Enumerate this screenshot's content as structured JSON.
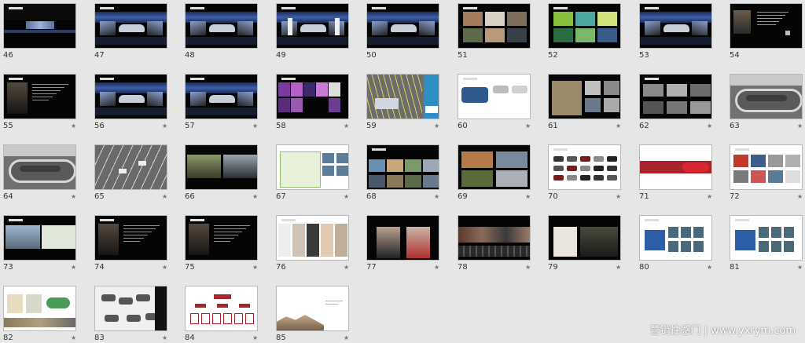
{
  "colors": {
    "background": "#e6e6e6",
    "star": "#777777"
  },
  "slides": [
    {
      "n": "46",
      "star": false,
      "v": "stage-wide"
    },
    {
      "n": "47",
      "star": false,
      "v": "stage"
    },
    {
      "n": "48",
      "star": false,
      "v": "stage"
    },
    {
      "n": "49",
      "star": false,
      "v": "stage-panels"
    },
    {
      "n": "50",
      "star": false,
      "v": "stage"
    },
    {
      "n": "51",
      "star": false,
      "v": "grid-photos"
    },
    {
      "n": "52",
      "star": false,
      "v": "green-grid"
    },
    {
      "n": "53",
      "star": false,
      "v": "stage"
    },
    {
      "n": "54",
      "star": false,
      "v": "people-text"
    },
    {
      "n": "55",
      "star": true,
      "v": "portrait-text"
    },
    {
      "n": "56",
      "star": true,
      "v": "stage"
    },
    {
      "n": "57",
      "star": true,
      "v": "stage"
    },
    {
      "n": "58",
      "star": true,
      "v": "purple-collage"
    },
    {
      "n": "59",
      "star": true,
      "v": "parking-blue"
    },
    {
      "n": "60",
      "star": true,
      "v": "white-cars"
    },
    {
      "n": "61",
      "star": true,
      "v": "map-photos"
    },
    {
      "n": "62",
      "star": true,
      "v": "dark-photos"
    },
    {
      "n": "63",
      "star": true,
      "v": "track"
    },
    {
      "n": "64",
      "star": true,
      "v": "track"
    },
    {
      "n": "65",
      "star": true,
      "v": "track-cars"
    },
    {
      "n": "66",
      "star": true,
      "v": "car-photos"
    },
    {
      "n": "67",
      "star": true,
      "v": "map-green"
    },
    {
      "n": "68",
      "star": true,
      "v": "landscape-strip"
    },
    {
      "n": "69",
      "star": true,
      "v": "four-photos"
    },
    {
      "n": "70",
      "star": true,
      "v": "white-car-grid"
    },
    {
      "n": "71",
      "star": true,
      "v": "red-banner"
    },
    {
      "n": "72",
      "star": true,
      "v": "white-collage"
    },
    {
      "n": "73",
      "star": true,
      "v": "building-map"
    },
    {
      "n": "74",
      "star": true,
      "v": "portrait-text"
    },
    {
      "n": "75",
      "star": true,
      "v": "portrait-text"
    },
    {
      "n": "76",
      "star": true,
      "v": "fashion"
    },
    {
      "n": "77",
      "star": true,
      "v": "two-portraits"
    },
    {
      "n": "78",
      "star": true,
      "v": "people-row"
    },
    {
      "n": "79",
      "star": true,
      "v": "interior"
    },
    {
      "n": "80",
      "star": true,
      "v": "white-blue"
    },
    {
      "n": "81",
      "star": true,
      "v": "white-blue"
    },
    {
      "n": "82",
      "star": true,
      "v": "white-docs"
    },
    {
      "n": "83",
      "star": true,
      "v": "white-objects"
    },
    {
      "n": "84",
      "star": true,
      "v": "org-chart"
    },
    {
      "n": "85",
      "star": true,
      "v": "white-landscape"
    }
  ],
  "watermark": "营销性感门 | www.yxrym.com"
}
